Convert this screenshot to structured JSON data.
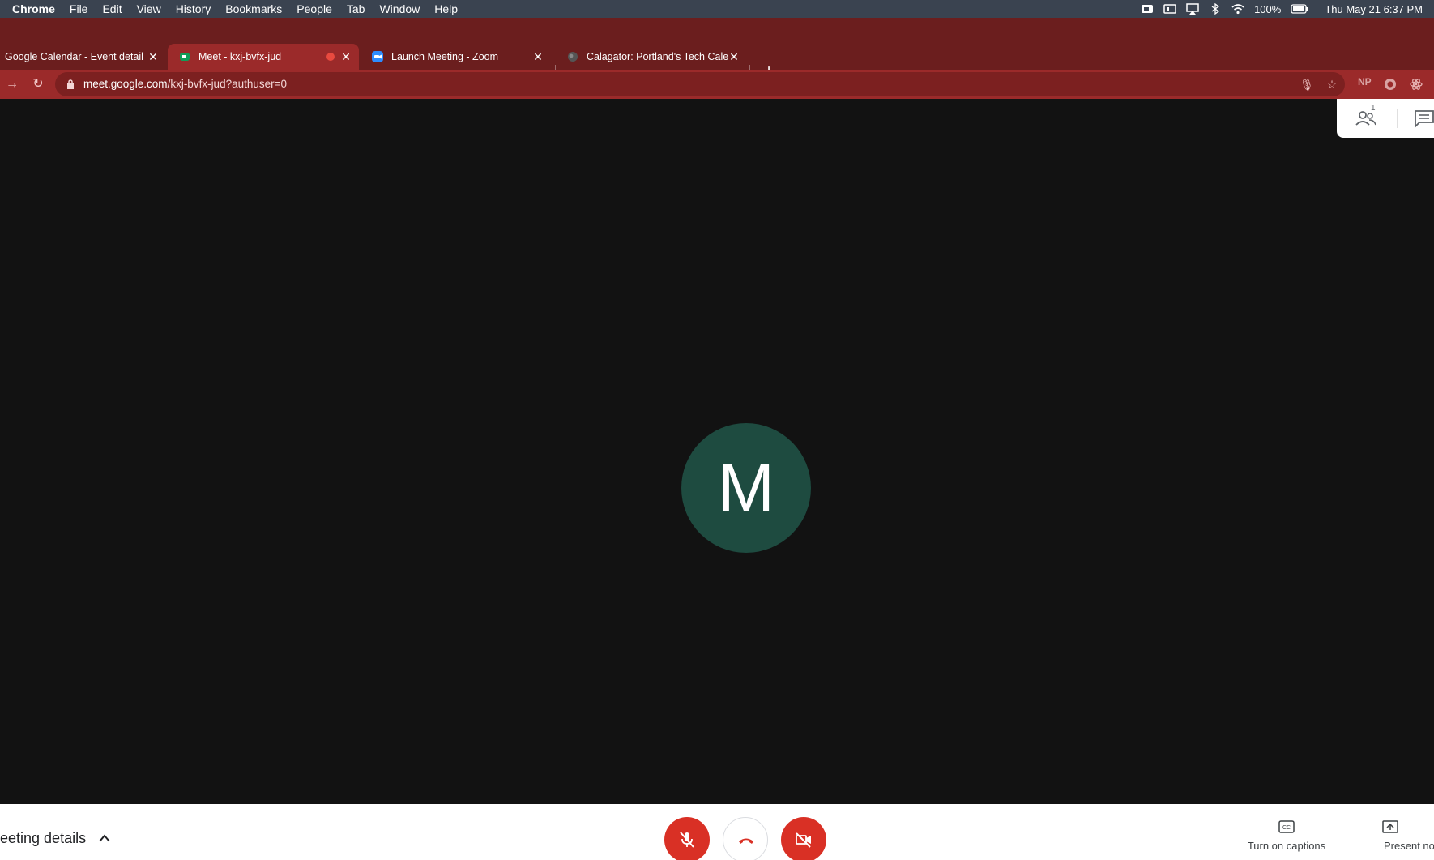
{
  "menubar": {
    "app_name": "Chrome",
    "items": [
      "File",
      "Edit",
      "View",
      "History",
      "Bookmarks",
      "People",
      "Tab",
      "Window",
      "Help"
    ],
    "battery": "100%",
    "datetime": "Thu May 21  6:37 PM"
  },
  "tabs": [
    {
      "title": "Google Calendar - Event detail",
      "active": false
    },
    {
      "title": "Meet - kxj-bvfx-jud",
      "active": true
    },
    {
      "title": "Launch Meeting - Zoom",
      "active": false
    },
    {
      "title": "Calagator: Portland's Tech Cale",
      "active": false
    }
  ],
  "toolbar": {
    "url_host": "meet.google.com",
    "url_path": "/kxj-bvfx-jud?authuser=0",
    "ext_np": "NP"
  },
  "meeting": {
    "avatar_initial": "M",
    "people_count": "1"
  },
  "bottombar": {
    "meeting_details": "eeting details",
    "captions_label": "Turn on captions",
    "present_label": "Present no"
  },
  "colors": {
    "tabstrip": "#6b1e1e",
    "active_tab": "#9b2a2a",
    "avatar": "#1e4b40",
    "control_red": "#d93025",
    "stage": "#121212"
  }
}
